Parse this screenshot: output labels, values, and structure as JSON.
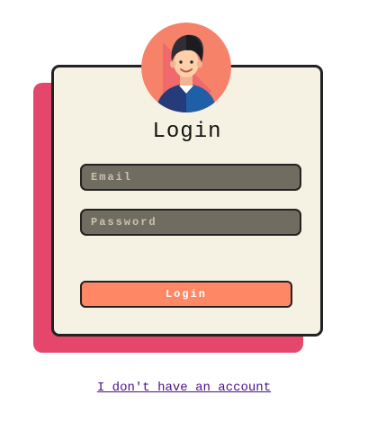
{
  "colors": {
    "accent_pink": "#e5466b",
    "card_background": "#f6f2e3",
    "field_background": "#716c60",
    "button_background": "#fe8766",
    "link_color": "#4b0f8a",
    "avatar_background": "#f7826a"
  },
  "login": {
    "title": "Login",
    "avatar_icon": "user-avatar-icon",
    "email": {
      "placeholder": "Email",
      "value": ""
    },
    "password": {
      "placeholder": "Password",
      "value": ""
    },
    "submit_label": "Login",
    "account_link": "I don't have an account"
  }
}
